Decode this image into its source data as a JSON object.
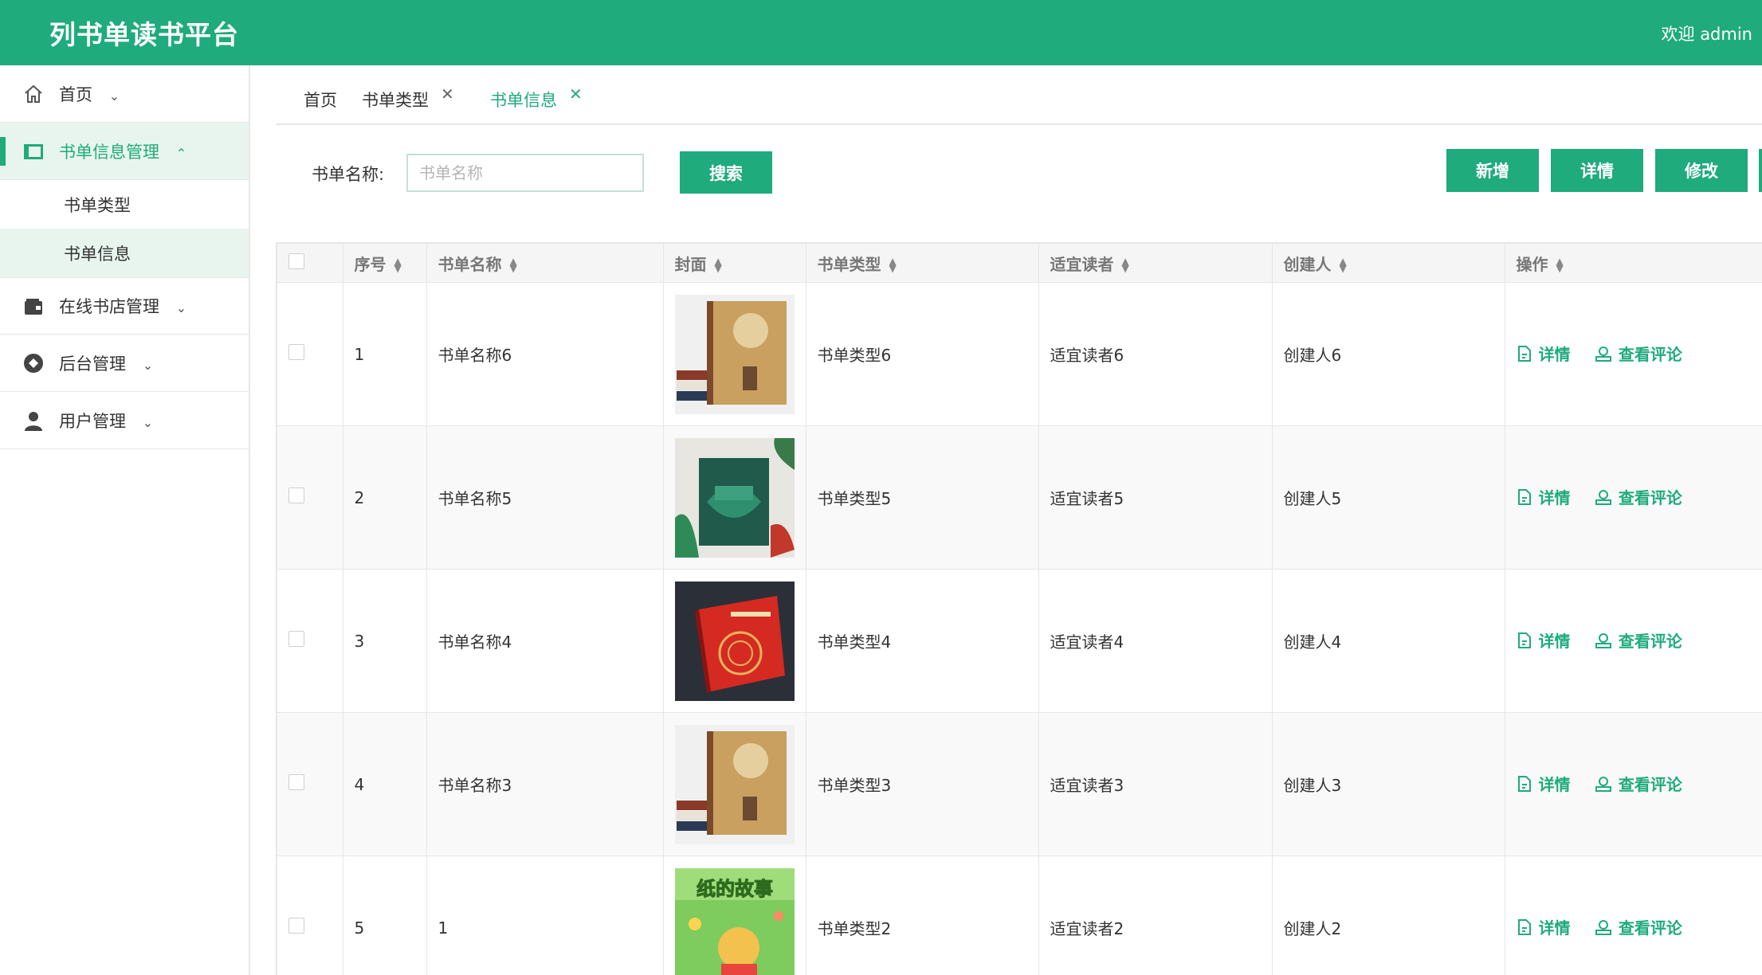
{
  "header": {
    "title": "列书单读书平台",
    "welcome": "欢迎 admin"
  },
  "sidebar": {
    "items": [
      {
        "label": "首页",
        "icon": "home-icon",
        "expanded": false
      },
      {
        "label": "书单信息管理",
        "icon": "book-icon",
        "expanded": true,
        "active": true,
        "children": [
          {
            "label": "书单类型"
          },
          {
            "label": "书单信息",
            "selected": true
          }
        ]
      },
      {
        "label": "在线书店管理",
        "icon": "wallet-icon",
        "expanded": false
      },
      {
        "label": "后台管理",
        "icon": "settings-icon",
        "expanded": false
      },
      {
        "label": "用户管理",
        "icon": "user-icon",
        "expanded": false
      }
    ]
  },
  "tabs": [
    {
      "label": "首页",
      "closable": false
    },
    {
      "label": "书单类型",
      "closable": true
    },
    {
      "label": "书单信息",
      "closable": true,
      "active": true
    }
  ],
  "search": {
    "label": "书单名称:",
    "placeholder": "书单名称",
    "value": "",
    "button": "搜索"
  },
  "toolbar": {
    "add": "新增",
    "detail": "详情",
    "edit": "修改"
  },
  "table": {
    "columns": [
      "序号",
      "书单名称",
      "封面",
      "书单类型",
      "适宜读者",
      "创建人",
      "操作"
    ],
    "actions": {
      "detail": "详情",
      "comments": "查看评论"
    },
    "rows": [
      {
        "index": "1",
        "name": "书单名称6",
        "cover": "antique-book-cover",
        "type": "书单类型6",
        "reader": "适宜读者6",
        "creator": "创建人6"
      },
      {
        "index": "2",
        "name": "书单名称5",
        "cover": "jungle-book-cover",
        "type": "书单类型5",
        "reader": "适宜读者5",
        "creator": "创建人5"
      },
      {
        "index": "3",
        "name": "书单名称4",
        "cover": "red-book-cover",
        "type": "书单类型4",
        "reader": "适宜读者4",
        "creator": "创建人4"
      },
      {
        "index": "4",
        "name": "书单名称3",
        "cover": "antique-book-cover",
        "type": "书单类型3",
        "reader": "适宜读者3",
        "creator": "创建人3"
      },
      {
        "index": "5",
        "name": "1",
        "cover": "paper-story-cover",
        "cover_title": "纸的故事",
        "type": "书单类型2",
        "reader": "适宜读者2",
        "creator": "创建人2"
      }
    ]
  },
  "colors": {
    "accent": "#1fab7b",
    "active_bg": "#e8f5ef"
  }
}
